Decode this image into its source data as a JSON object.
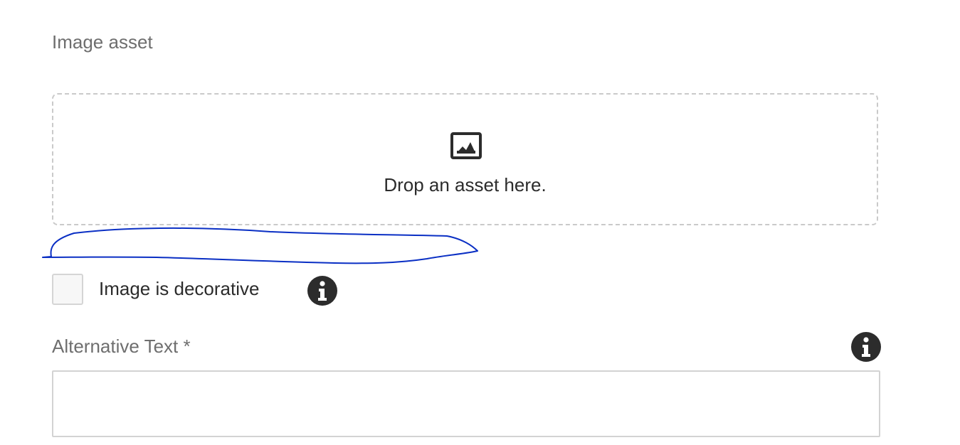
{
  "image_asset": {
    "label": "Image asset",
    "dropzone_icon": "image-icon",
    "dropzone_text": "Drop an asset here."
  },
  "annotation": {
    "color": "#0a2fc4"
  },
  "decorative": {
    "label": "Image is decorative",
    "checked": false,
    "info_icon": "info-icon"
  },
  "alt_text": {
    "label": "Alternative Text *",
    "value": "",
    "info_icon": "info-icon"
  }
}
